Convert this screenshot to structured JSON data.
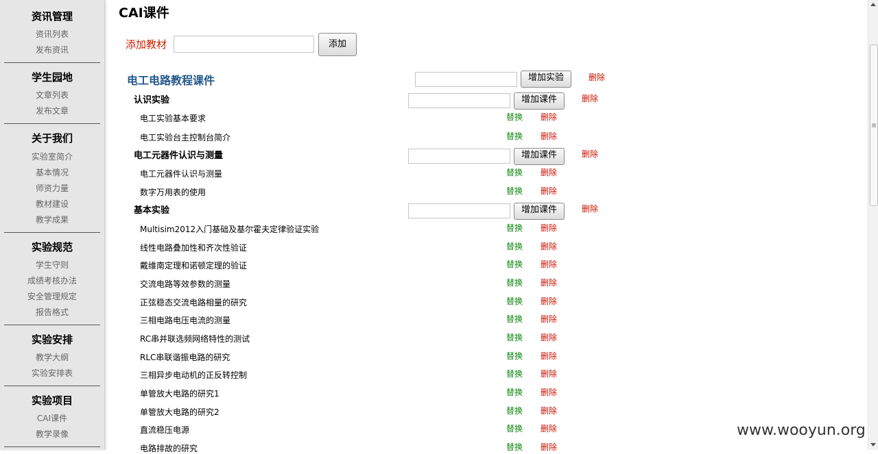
{
  "sidebar": {
    "sections": [
      {
        "title": "资讯管理",
        "links": [
          "资讯列表",
          "发布资讯"
        ]
      },
      {
        "title": "学生园地",
        "links": [
          "文章列表",
          "发布文章"
        ]
      },
      {
        "title": "关于我们",
        "links": [
          "实验室简介",
          "基本情况",
          "师资力量",
          "教材建设",
          "教学成果"
        ]
      },
      {
        "title": "实验规范",
        "links": [
          "学生守则",
          "成绩考核办法",
          "安全管理规定",
          "报告格式"
        ]
      },
      {
        "title": "实验安排",
        "links": [
          "教学大纲",
          "实验安排表"
        ]
      },
      {
        "title": "实验项目",
        "links": [
          "CAI课件",
          "教学录像"
        ]
      }
    ]
  },
  "main": {
    "title": "CAI课件",
    "add_material": {
      "label": "添加教材",
      "input_value": "",
      "button": "添加"
    },
    "course": {
      "title": "电工电路教程课件",
      "input_value": "",
      "add_button": "增加实验",
      "delete": "删除",
      "groups": [
        {
          "title": "认识实验",
          "add_button": "增加课件",
          "delete": "删除",
          "items": [
            "电工实验基本要求",
            "电工实验台主控制台简介"
          ]
        },
        {
          "title": "电工元器件认识与测量",
          "add_button": "增加课件",
          "delete": "删除",
          "items": [
            "电工元器件认识与测量",
            "数字万用表的使用"
          ]
        },
        {
          "title": "基本实验",
          "add_button": "增加课件",
          "delete": "删除",
          "items": [
            "Multisim2012入门基础及基尔霍夫定律验证实验",
            "线性电路叠加性和齐次性验证",
            "戴维南定理和诺顿定理的验证",
            "交流电路等效参数的测量",
            "正弦稳态交流电路相量的研究",
            "三相电路电压电流的测量",
            "RC串并联选频网络特性的测试",
            "RLC串联谐振电路的研究",
            "三相异步电动机的正反转控制",
            "单管放大电路的研究1",
            "单管放大电路的研究2",
            "直流稳压电源",
            "电路排故的研究"
          ]
        }
      ]
    },
    "item_actions": {
      "replace": "替换",
      "delete": "删除"
    }
  },
  "watermark": "www.wooyun.org",
  "colors": {
    "sidebar_bg": "#e6e6e6",
    "course_title": "#23578a",
    "replace": "#118811",
    "delete": "#cc1100",
    "add_label": "#cc2200"
  }
}
